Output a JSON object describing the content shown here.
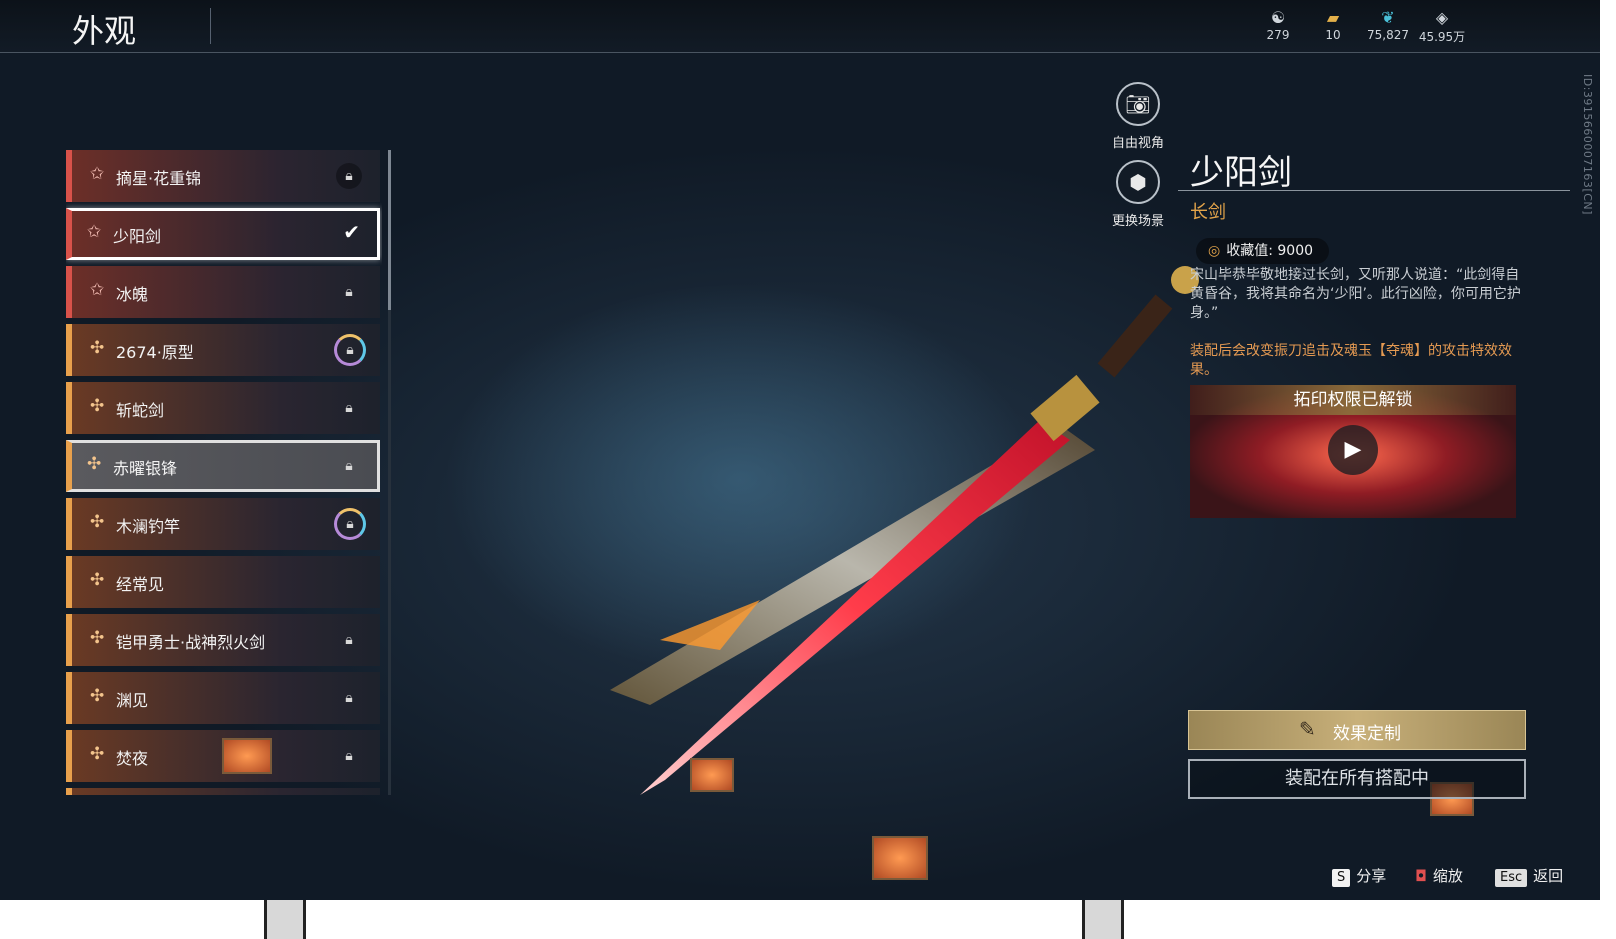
{
  "header": {
    "title": "外观",
    "currencies": [
      {
        "icon": "spirit-coin-icon",
        "value": "279"
      },
      {
        "icon": "ticket-icon",
        "value": "10"
      },
      {
        "icon": "feather-icon",
        "value": "75,827"
      },
      {
        "icon": "diamond-icon",
        "value": "45.95万"
      }
    ]
  },
  "id_text": "ID:3915660007163[CN]",
  "list": {
    "items": [
      {
        "name": "摘星·花重锦",
        "icon": "star-icon",
        "state": "locked"
      },
      {
        "name": "少阳剑",
        "icon": "star-icon",
        "state": "equipped"
      },
      {
        "name": "冰魄",
        "icon": "star-icon",
        "state": "locked"
      },
      {
        "name": "2674·原型",
        "icon": "cross-icon",
        "state": "locked-ring"
      },
      {
        "name": "斩蛇剑",
        "icon": "cross-icon",
        "state": "locked"
      },
      {
        "name": "赤曜银锋",
        "icon": "cross-icon",
        "state": "locked"
      },
      {
        "name": "木澜钓竿",
        "icon": "cross-icon",
        "state": "locked-ring"
      },
      {
        "name": "经常见",
        "icon": "cross-icon",
        "state": "none"
      },
      {
        "name": "铠甲勇士·战神烈火剑",
        "icon": "cross-icon",
        "state": "locked"
      },
      {
        "name": "渊见",
        "icon": "cross-icon",
        "state": "locked"
      },
      {
        "name": "焚夜",
        "icon": "cross-icon",
        "state": "locked"
      }
    ]
  },
  "tools": {
    "free_view": "自由视角",
    "change_scene": "更换场景"
  },
  "detail": {
    "name": "少阳剑",
    "type": "长剑",
    "collection_label": "收藏值: 9000",
    "description": "宋山毕恭毕敬地接过长剑，又听那人说道：“此剑得自黄昏谷，我将其命名为‘少阳’。此行凶险，你可用它护身。”",
    "effect": "装配后会改变振刀追击及魂玉【夺魂】的攻击特效效果。",
    "unlock_title": "拓印权限已解锁",
    "custom_button": "效果定制",
    "equip_button": "装配在所有搭配中"
  },
  "hints": {
    "share_key": "S",
    "share": "分享",
    "zoom": "缩放",
    "back_key": "Esc",
    "back": "返回"
  },
  "colors": {
    "red_rarity": "#d8524a",
    "gold_rarity": "#e8a04c",
    "accent": "#e3a44a"
  }
}
